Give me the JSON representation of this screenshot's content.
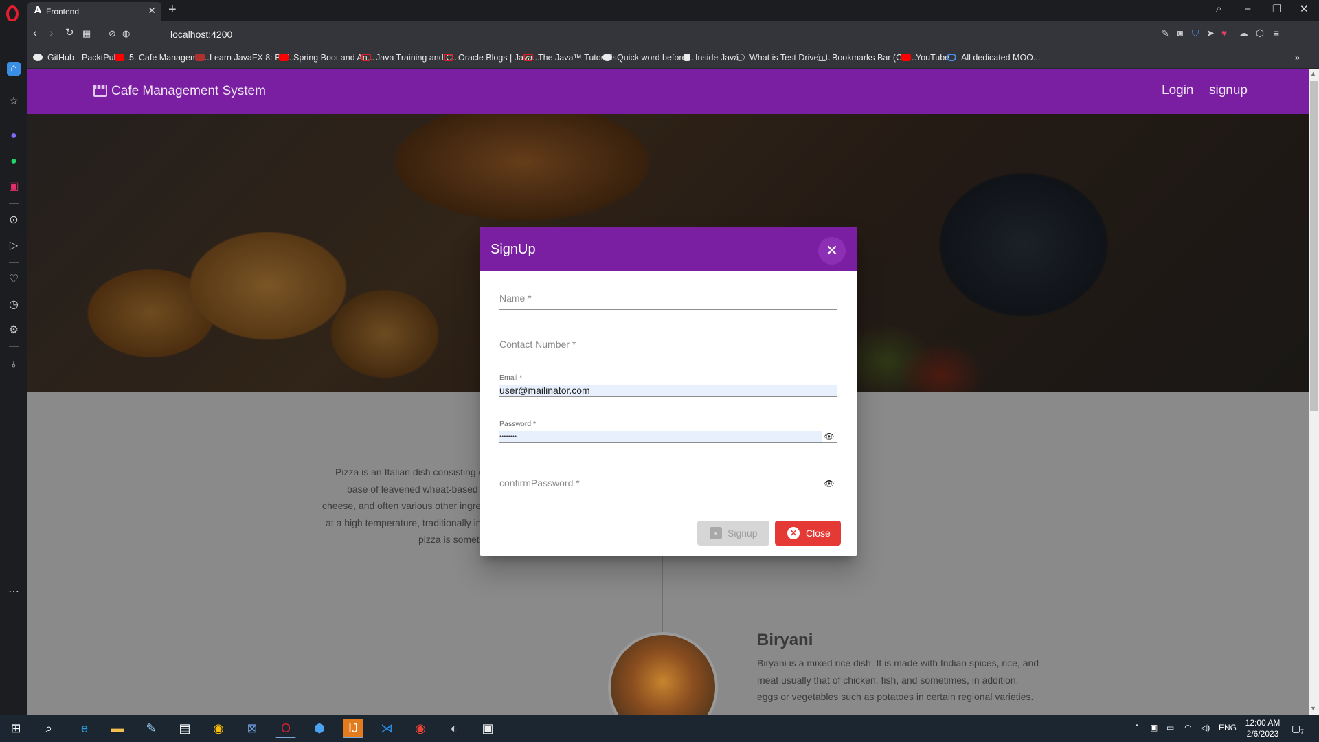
{
  "browser": {
    "tab_title": "Frontend",
    "tab_favicon": "A",
    "url": "localhost:4200",
    "bookmarks": [
      {
        "label": "GitHub - PacktPubli...",
        "color": "#eaeaea"
      },
      {
        "label": "5. Cafe Manageme...",
        "color": "#ff0000"
      },
      {
        "label": "Learn JavaFX 8: Buil...",
        "color": "#b03030"
      },
      {
        "label": "Spring Boot and An...",
        "color": "#ff0000"
      },
      {
        "label": "Java Training and C...",
        "color": "#e02020"
      },
      {
        "label": "Oracle Blogs | Java...",
        "color": "#e02020"
      },
      {
        "label": "The Java™ Tutorials",
        "color": "#e02020"
      },
      {
        "label": "Quick word before...",
        "color": "#eaeaea"
      },
      {
        "label": "Inside Java",
        "color": "#eaeaea"
      },
      {
        "label": "What is Test Driven...",
        "color": "#eaeaea"
      },
      {
        "label": "Bookmarks Bar (Chr...",
        "color": "#eaeaea"
      },
      {
        "label": "YouTube",
        "color": "#ff0000"
      },
      {
        "label": "All dedicated MOO...",
        "color": "#4a90e2"
      }
    ]
  },
  "app": {
    "brand": "Cafe Management System",
    "nav": {
      "login": "Login",
      "signup": "signup"
    },
    "about_lines": [
      "Pizza is an Italian dish consisting of a us",
      "base of leavened wheat-based dough t",
      "cheese, and often various other ingredients",
      "at a high temperature, traditionally in a woo",
      "pizza is sometim"
    ],
    "section_title": "Biryani",
    "section_lines": [
      "Biryani is a mixed rice dish. It is made with Indian spices, rice, and",
      "meat usually that of chicken, fish, and sometimes, in addition,",
      "eggs or vegetables such as potatoes in certain regional varieties."
    ]
  },
  "dialog": {
    "title": "SignUp",
    "close_glyph": "✕",
    "fields": {
      "name": {
        "label": "Name *"
      },
      "contact": {
        "label": "Contact Number *"
      },
      "email": {
        "label": "Email *",
        "value": "user@mailinator.com"
      },
      "password": {
        "label": "Password *",
        "value": "••••••••"
      },
      "confirm": {
        "label": "confirmPassword *"
      }
    },
    "buttons": {
      "signup": "Signup",
      "close": "Close"
    }
  },
  "taskbar": {
    "language": "ENG",
    "time": "12:00 AM",
    "date": "2/6/2023",
    "notification_count": "7"
  },
  "colors": {
    "primary": "#7b1fa2",
    "warn": "#e53935",
    "autofill": "#e8f0fe"
  }
}
